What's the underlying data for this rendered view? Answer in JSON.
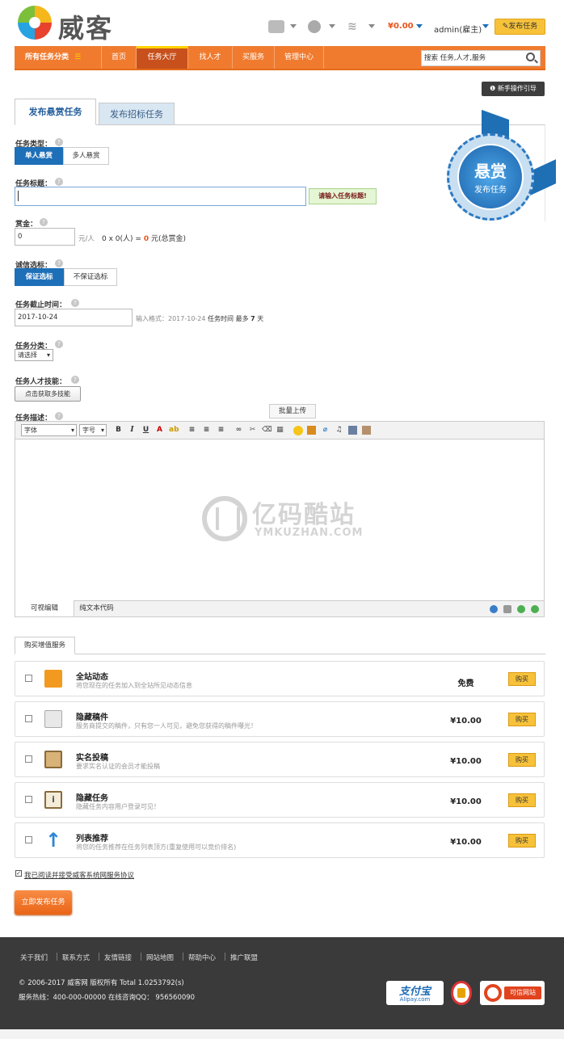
{
  "header": {
    "logo_text": "威客",
    "balance": "¥0.00",
    "user": "admin(雇主)",
    "publish_button": "发布任务"
  },
  "nav": {
    "all_categories": "所有任务分类",
    "items": [
      "首页",
      "任务大厅",
      "找人才",
      "买服务",
      "管理中心"
    ],
    "active_index": 1,
    "search_placeholder": "搜索 任务,人才,服务"
  },
  "guide_button": "新手操作引导",
  "tabs": {
    "publish_reward": "发布悬赏任务",
    "publish_bid": "发布招标任务"
  },
  "form": {
    "task_type": {
      "label": "任务类型：",
      "options": [
        "单人悬赏",
        "多人悬赏"
      ],
      "selected": "单人悬赏"
    },
    "task_title": {
      "label": "任务标题：",
      "value": "",
      "tip": "请输入任务标题!"
    },
    "reward": {
      "label": "赏金：",
      "value": "0",
      "unit": "元/人",
      "formula_prefix": "0 x 0(人) =",
      "total": "0",
      "formula_suffix": "元(总赏金)"
    },
    "integrity": {
      "label": "诚信选标：",
      "options": [
        "保证选标",
        "不保证选标"
      ],
      "selected": "保证选标"
    },
    "deadline": {
      "label": "任务截止时间：",
      "value": "2017-10-24",
      "hint_prefix": "输入格式：2017-10-24",
      "hint_mid": "任务时间",
      "hint_max": "最多",
      "days": "7",
      "hint_unit": "天"
    },
    "category": {
      "label": "任务分类：",
      "selected": "请选择"
    },
    "skills": {
      "label": "任务人才技能：",
      "button": "点击获取多技能"
    },
    "description": {
      "label": "任务描述："
    }
  },
  "badge": {
    "line1": "悬赏",
    "line2": "发布任务"
  },
  "editor": {
    "font_select": "字体",
    "size_select": "字号",
    "tooltip": "批量上传",
    "tab_visual": "可视编辑",
    "tab_code": "纯文本代码"
  },
  "watermark": {
    "title": "亿码酷站",
    "subtitle": "YMKUZHAN.COM"
  },
  "services": {
    "tab": "购买增值服务",
    "buy_label": "购买",
    "items": [
      {
        "title": "全站动态",
        "desc": "将您现在的任务加入到全站所见动态信息",
        "price": "免费",
        "icon": "rss-icon",
        "color": "#f29a1f"
      },
      {
        "title": "隐藏稿件",
        "desc": "服务商提交的稿件，只有您一人可见，避免您获得的稿件曝光！",
        "price": "¥10.00",
        "icon": "edit-doc-icon",
        "color": "#b6b6b6"
      },
      {
        "title": "实名投稿",
        "desc": "要求实名认证的会员才能投稿",
        "price": "¥10.00",
        "icon": "clipboard-icon",
        "color": "#c79a4c"
      },
      {
        "title": "隐藏任务",
        "desc": "隐藏任务内容用户登录可见！",
        "price": "¥10.00",
        "icon": "info-clipboard-icon",
        "color": "#c79a4c"
      },
      {
        "title": "列表推荐",
        "desc": "将您的任务推荐在任务列表顶方(重复使用可以竞价排名)",
        "price": "¥10.00",
        "icon": "arrow-up-icon",
        "color": "#2d86d6"
      }
    ]
  },
  "agreement": "我已阅读并接受威客系统网服务协议",
  "submit_button": "立即发布任务",
  "footer": {
    "links": [
      "关于我们",
      "联系方式",
      "友情链接",
      "网站地图",
      "帮助中心",
      "推广联盟"
    ],
    "copyright": "© 2006-2017 威客网 版权所有 Total 1.0253792(s)",
    "hotline": "服务热线：400-000-00000 在线咨询QQ： 956560090",
    "alipay": "支付宝",
    "alipay_sub": "Alipay.com",
    "credit": "可信网站"
  }
}
